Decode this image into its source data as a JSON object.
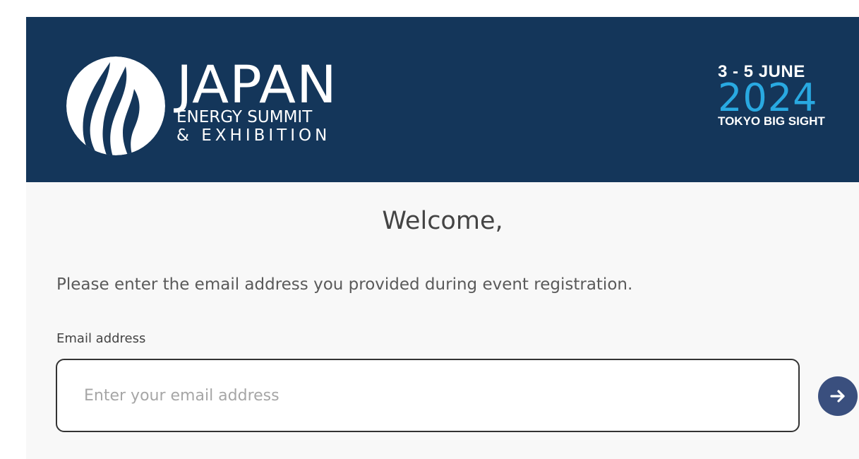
{
  "header": {
    "logo_title": "JAPAN",
    "logo_line2": "ENERGY SUMMIT",
    "logo_line3": "& EXHIBITION",
    "event_dates": "3 - 5 JUNE",
    "event_year": "2024",
    "event_venue": "TOKYO BIG SIGHT",
    "banner_color": "#14365a",
    "accent_color": "#29a9e1"
  },
  "login": {
    "welcome": "Welcome,",
    "instructions": "Please enter the email address you provided during event registration.",
    "email_label": "Email address",
    "email_value": "",
    "email_placeholder": "Enter your email address",
    "submit_icon": "arrow-right-icon",
    "button_color": "#3a4f7e"
  }
}
